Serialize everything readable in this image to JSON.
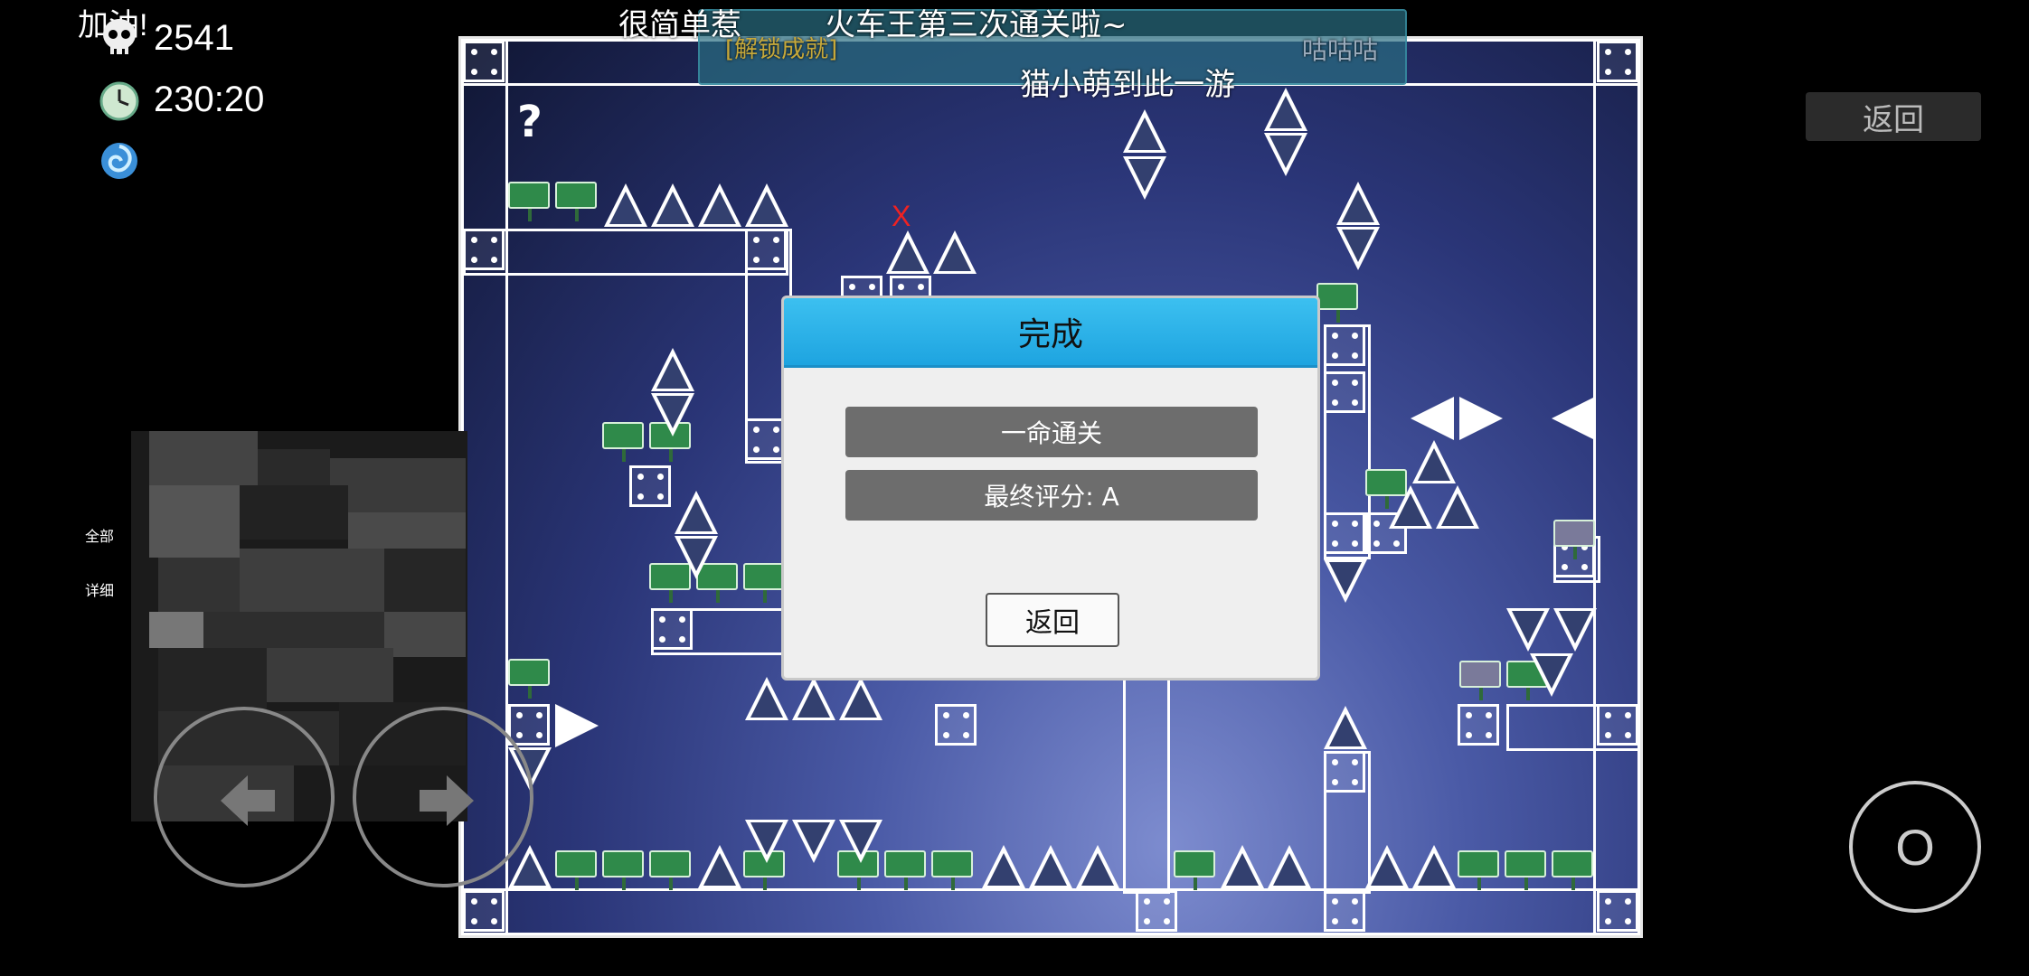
{
  "hud": {
    "cheer_text": "加油!",
    "deaths": "2541",
    "time": "230:20",
    "skull_icon": "skull-icon",
    "clock_icon": "clock-icon",
    "swirl_icon": "swirl-icon"
  },
  "danmaku": {
    "line1": "很简单",
    "line1_cont": "惹",
    "line2": "火车王第三次通关啦~",
    "line3_left": "[解锁成就]",
    "line3_right": "咕咕咕",
    "line4": "猫小萌到此一游"
  },
  "game": {
    "hint_mark": "?",
    "x_mark": "X"
  },
  "dialog": {
    "title": "完成",
    "achievement": "一命通关",
    "final_score": "最终评分: A",
    "back_label": "返回"
  },
  "controls": {
    "back_top_label": "返回",
    "jump_label": "O",
    "left_arrow_icon": "arrow-left-icon",
    "right_arrow_icon": "arrow-right-icon",
    "side_tab_all": "全部",
    "side_tab_detail": "详细"
  },
  "colors": {
    "dialog_header": "#1ea4e0",
    "pill_bg": "#6d6d6d",
    "game_bg": "#2a3577"
  }
}
